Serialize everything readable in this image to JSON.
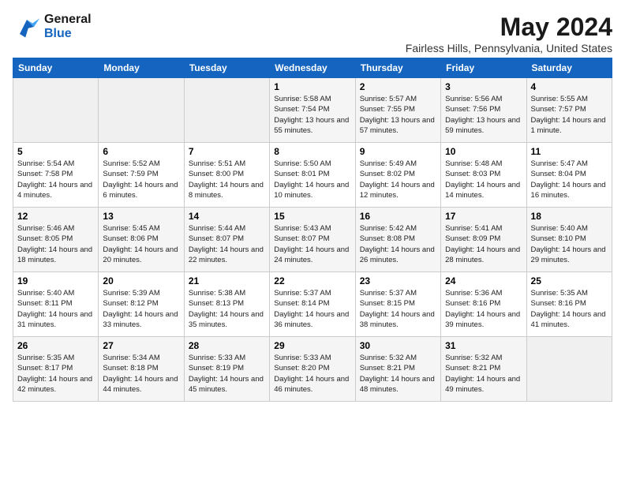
{
  "logo": {
    "line1": "General",
    "line2": "Blue"
  },
  "title": "May 2024",
  "location": "Fairless Hills, Pennsylvania, United States",
  "days_of_week": [
    "Sunday",
    "Monday",
    "Tuesday",
    "Wednesday",
    "Thursday",
    "Friday",
    "Saturday"
  ],
  "weeks": [
    [
      {
        "day": "",
        "info": ""
      },
      {
        "day": "",
        "info": ""
      },
      {
        "day": "",
        "info": ""
      },
      {
        "day": "1",
        "info": "Sunrise: 5:58 AM\nSunset: 7:54 PM\nDaylight: 13 hours and 55 minutes."
      },
      {
        "day": "2",
        "info": "Sunrise: 5:57 AM\nSunset: 7:55 PM\nDaylight: 13 hours and 57 minutes."
      },
      {
        "day": "3",
        "info": "Sunrise: 5:56 AM\nSunset: 7:56 PM\nDaylight: 13 hours and 59 minutes."
      },
      {
        "day": "4",
        "info": "Sunrise: 5:55 AM\nSunset: 7:57 PM\nDaylight: 14 hours and 1 minute."
      }
    ],
    [
      {
        "day": "5",
        "info": "Sunrise: 5:54 AM\nSunset: 7:58 PM\nDaylight: 14 hours and 4 minutes."
      },
      {
        "day": "6",
        "info": "Sunrise: 5:52 AM\nSunset: 7:59 PM\nDaylight: 14 hours and 6 minutes."
      },
      {
        "day": "7",
        "info": "Sunrise: 5:51 AM\nSunset: 8:00 PM\nDaylight: 14 hours and 8 minutes."
      },
      {
        "day": "8",
        "info": "Sunrise: 5:50 AM\nSunset: 8:01 PM\nDaylight: 14 hours and 10 minutes."
      },
      {
        "day": "9",
        "info": "Sunrise: 5:49 AM\nSunset: 8:02 PM\nDaylight: 14 hours and 12 minutes."
      },
      {
        "day": "10",
        "info": "Sunrise: 5:48 AM\nSunset: 8:03 PM\nDaylight: 14 hours and 14 minutes."
      },
      {
        "day": "11",
        "info": "Sunrise: 5:47 AM\nSunset: 8:04 PM\nDaylight: 14 hours and 16 minutes."
      }
    ],
    [
      {
        "day": "12",
        "info": "Sunrise: 5:46 AM\nSunset: 8:05 PM\nDaylight: 14 hours and 18 minutes."
      },
      {
        "day": "13",
        "info": "Sunrise: 5:45 AM\nSunset: 8:06 PM\nDaylight: 14 hours and 20 minutes."
      },
      {
        "day": "14",
        "info": "Sunrise: 5:44 AM\nSunset: 8:07 PM\nDaylight: 14 hours and 22 minutes."
      },
      {
        "day": "15",
        "info": "Sunrise: 5:43 AM\nSunset: 8:07 PM\nDaylight: 14 hours and 24 minutes."
      },
      {
        "day": "16",
        "info": "Sunrise: 5:42 AM\nSunset: 8:08 PM\nDaylight: 14 hours and 26 minutes."
      },
      {
        "day": "17",
        "info": "Sunrise: 5:41 AM\nSunset: 8:09 PM\nDaylight: 14 hours and 28 minutes."
      },
      {
        "day": "18",
        "info": "Sunrise: 5:40 AM\nSunset: 8:10 PM\nDaylight: 14 hours and 29 minutes."
      }
    ],
    [
      {
        "day": "19",
        "info": "Sunrise: 5:40 AM\nSunset: 8:11 PM\nDaylight: 14 hours and 31 minutes."
      },
      {
        "day": "20",
        "info": "Sunrise: 5:39 AM\nSunset: 8:12 PM\nDaylight: 14 hours and 33 minutes."
      },
      {
        "day": "21",
        "info": "Sunrise: 5:38 AM\nSunset: 8:13 PM\nDaylight: 14 hours and 35 minutes."
      },
      {
        "day": "22",
        "info": "Sunrise: 5:37 AM\nSunset: 8:14 PM\nDaylight: 14 hours and 36 minutes."
      },
      {
        "day": "23",
        "info": "Sunrise: 5:37 AM\nSunset: 8:15 PM\nDaylight: 14 hours and 38 minutes."
      },
      {
        "day": "24",
        "info": "Sunrise: 5:36 AM\nSunset: 8:16 PM\nDaylight: 14 hours and 39 minutes."
      },
      {
        "day": "25",
        "info": "Sunrise: 5:35 AM\nSunset: 8:16 PM\nDaylight: 14 hours and 41 minutes."
      }
    ],
    [
      {
        "day": "26",
        "info": "Sunrise: 5:35 AM\nSunset: 8:17 PM\nDaylight: 14 hours and 42 minutes."
      },
      {
        "day": "27",
        "info": "Sunrise: 5:34 AM\nSunset: 8:18 PM\nDaylight: 14 hours and 44 minutes."
      },
      {
        "day": "28",
        "info": "Sunrise: 5:33 AM\nSunset: 8:19 PM\nDaylight: 14 hours and 45 minutes."
      },
      {
        "day": "29",
        "info": "Sunrise: 5:33 AM\nSunset: 8:20 PM\nDaylight: 14 hours and 46 minutes."
      },
      {
        "day": "30",
        "info": "Sunrise: 5:32 AM\nSunset: 8:21 PM\nDaylight: 14 hours and 48 minutes."
      },
      {
        "day": "31",
        "info": "Sunrise: 5:32 AM\nSunset: 8:21 PM\nDaylight: 14 hours and 49 minutes."
      },
      {
        "day": "",
        "info": ""
      }
    ]
  ]
}
